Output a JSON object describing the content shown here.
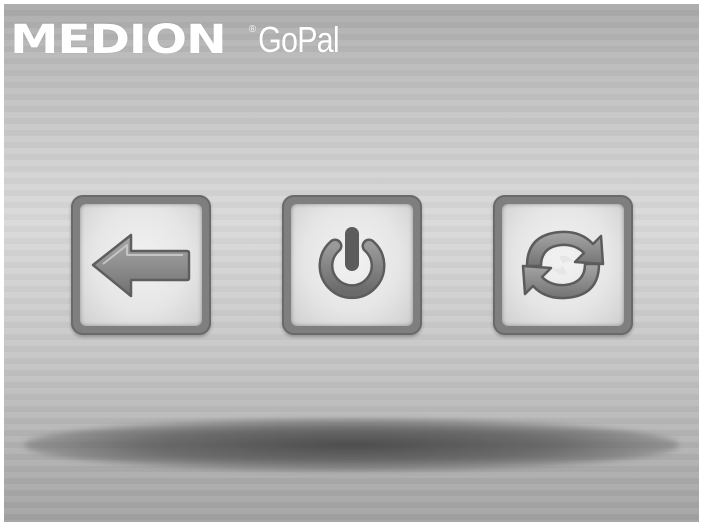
{
  "header": {
    "brand_primary": "MEDION",
    "brand_mark": "®",
    "brand_secondary": "GoPal"
  },
  "buttons": [
    {
      "id": "back",
      "icon": "arrow-left-icon"
    },
    {
      "id": "power",
      "icon": "power-icon"
    },
    {
      "id": "sync",
      "icon": "sync-icon"
    }
  ],
  "colors": {
    "background_light": "#d9d9d9",
    "background_dark": "#a2a2a2",
    "button_frame": "#7f7f7f",
    "button_face": "#e6e6e6",
    "icon_fill": "#8a8a8a",
    "logo_text": "#ffffff"
  }
}
